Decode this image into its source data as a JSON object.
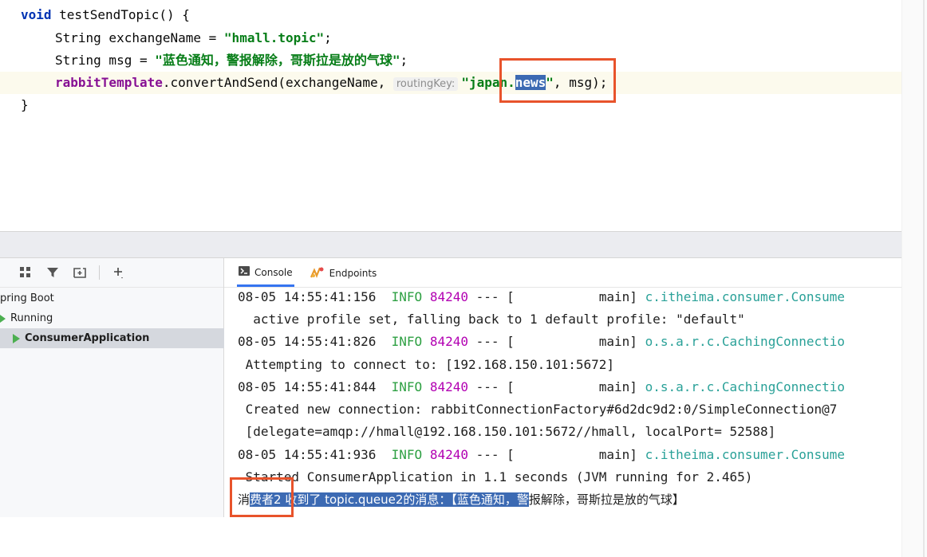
{
  "editor": {
    "line1": {
      "kw": "void",
      "rest": " testSendTopic() {"
    },
    "line2": {
      "type": "String",
      "rest": " exchangeName = ",
      "value": "\"hmall.topic\"",
      "end": ";"
    },
    "line3": {
      "type": "String",
      "rest": " msg = ",
      "value": "\"蓝色通知，警报解除，哥斯拉是放的气球\"",
      "end": ";"
    },
    "line4": {
      "field": "rabbitTemplate",
      "call": ".convertAndSend(exchangeName, ",
      "hint": "routingKey:",
      "key_prefix": "\"japan.",
      "key_selected": "news",
      "key_suffix": "\"",
      "tail": ", msg);"
    },
    "line5": "}"
  },
  "run_panel": {
    "tree": [
      {
        "label": "pring Boot"
      },
      {
        "label": "Running"
      },
      {
        "label": "ConsumerApplication"
      }
    ]
  },
  "console": {
    "tabs": [
      {
        "label": "Console"
      },
      {
        "label": "Endpoints"
      }
    ],
    "lines": [
      {
        "ts": "08-05 14:55:41:156",
        "level": "INFO",
        "pid": "84240",
        "mid": " --- [           main] ",
        "logger": "c.itheima.consumer.Consume"
      },
      {
        "text": "  active profile set, falling back to 1 default profile: \"default\""
      },
      {
        "ts": "08-05 14:55:41:826",
        "level": "INFO",
        "pid": "84240",
        "mid": " --- [           main] ",
        "logger": "o.s.a.r.c.CachingConnectio"
      },
      {
        "text": " Attempting to connect to: [192.168.150.101:5672]"
      },
      {
        "ts": "08-05 14:55:41:844",
        "level": "INFO",
        "pid": "84240",
        "mid": " --- [           main] ",
        "logger": "o.s.a.r.c.CachingConnectio"
      },
      {
        "text": " Created new connection: rabbitConnectionFactory#6d2dc9d2:0/SimpleConnection@7"
      },
      {
        "text": " [delegate=amqp://hmall@192.168.150.101:5672//hmall, localPort= 52588]"
      },
      {
        "ts": "08-05 14:55:41:936",
        "level": "INFO",
        "pid": "84240",
        "mid": " --- [           main] ",
        "logger": "c.itheima.consumer.Consume"
      },
      {
        "text": " Started ConsumerApplication in 1.1 seconds (JVM running for 2.465)"
      }
    ],
    "message": {
      "pre": "消",
      "selected": "费者2 收到了 topic.queue2的消息：【蓝色通知，警",
      "post": "报解除，哥斯拉是放的气球】"
    }
  },
  "colors": {
    "highlight_box": "#e8532b",
    "selection": "#3c6ab3",
    "info": "#2ea043"
  }
}
